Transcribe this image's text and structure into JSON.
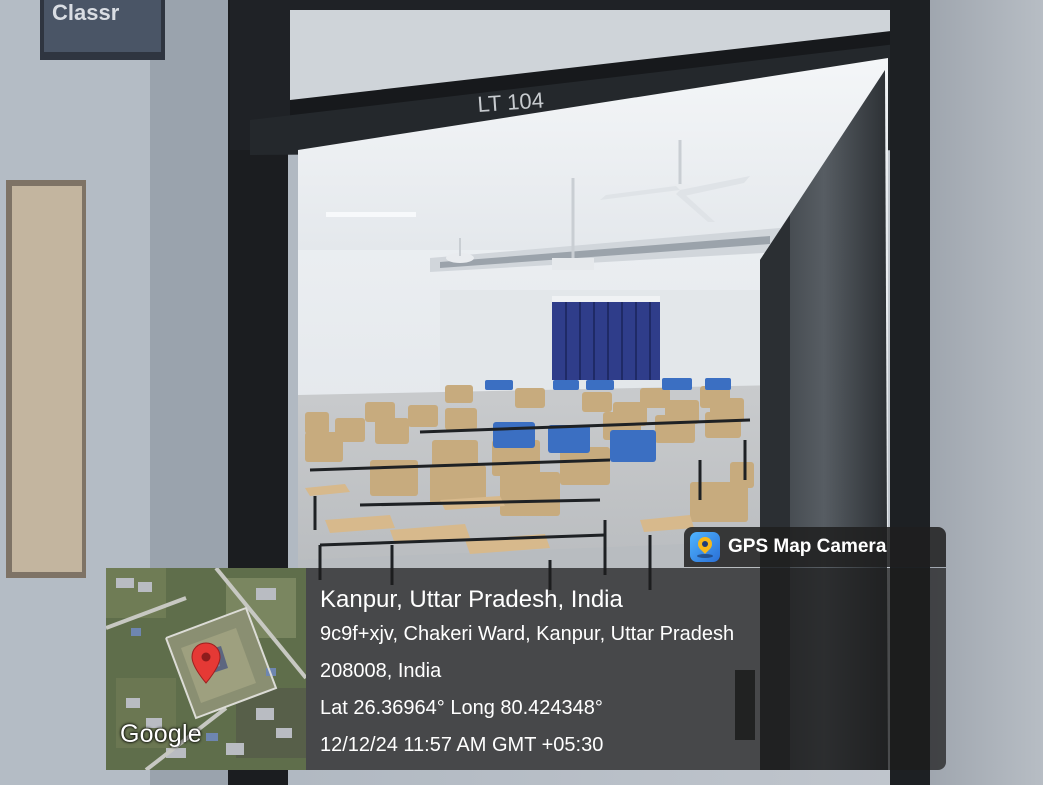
{
  "photo": {
    "door_label": "LT 104",
    "sign_text": "Classr"
  },
  "gps_camera": {
    "app_name": "GPS Map Camera",
    "app_icon": "map-pin-icon",
    "map_attribution": "Google",
    "place": "Kanpur, Uttar Pradesh, India",
    "address_line1": "9c9f+xjv, Chakeri Ward, Kanpur, Uttar Pradesh",
    "address_line2": "208008, India",
    "coordinates": "Lat 26.36964° Long 80.424348°",
    "datetime": "12/12/24 11:57 AM GMT +05:30",
    "colors": {
      "panel": "#1c1c1c",
      "pin": "#e53935",
      "icon_bg": "#2f86e8"
    }
  }
}
